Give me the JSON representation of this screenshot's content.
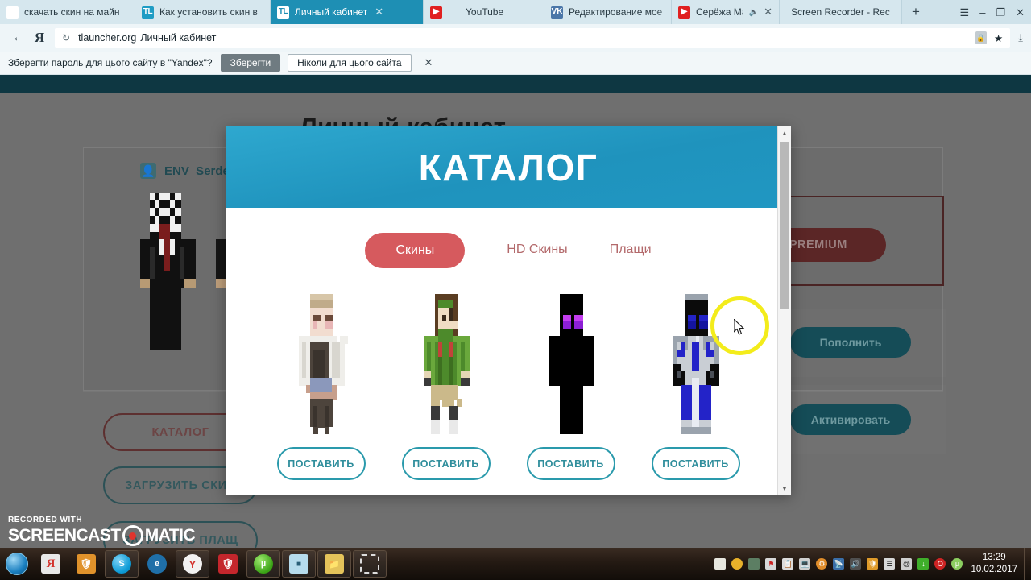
{
  "browser": {
    "tabs": [
      {
        "label": "скачать скин на майн",
        "favicon": "yandex-icon",
        "active": false,
        "closable": false,
        "muted": false
      },
      {
        "label": "Как установить скин в",
        "favicon": "tlauncher-icon",
        "active": false,
        "closable": false,
        "muted": false
      },
      {
        "label": "Личный кабинет",
        "favicon": "tlauncher-icon",
        "active": true,
        "closable": true,
        "muted": false
      },
      {
        "label": "YouTube",
        "favicon": "youtube-icon",
        "active": false,
        "closable": false,
        "muted": false
      },
      {
        "label": "Редактирование мое",
        "favicon": "vk-icon",
        "active": false,
        "closable": false,
        "muted": false
      },
      {
        "label": "Серёжа Магерк",
        "favicon": "youtube-icon",
        "active": false,
        "closable": true,
        "muted": true
      },
      {
        "label": "Screen Recorder - Rec",
        "favicon": "none",
        "active": false,
        "closable": false,
        "muted": false
      }
    ],
    "new_tab_label": "+",
    "window_controls": {
      "menu": "☰",
      "minimize": "–",
      "maximize": "❐",
      "close": "✕"
    },
    "toolbar": {
      "back_icon": "←",
      "brand_icon": "Я",
      "reload_icon": "↻",
      "url_host": "tlauncher.org",
      "url_title": "Личный кабинет",
      "lock_icon": "❖",
      "bookmark_icon": "★",
      "download_icon": "⤓"
    },
    "password_bar": {
      "text": "Зберегти пароль для цього сайту в \"Yandex\"?",
      "save_label": "Зберегти",
      "never_label": "Ніколи для цього сайта",
      "close_icon": "✕"
    }
  },
  "page": {
    "title": "Личный кабинет",
    "username": "ENV_Serden",
    "user_icon": "person-icon",
    "left_buttons": [
      {
        "label": "КАТАЛОГ",
        "style": "red-outline"
      },
      {
        "label": "ЗАГРУЗИТЬ СКИН",
        "style": "teal-outline"
      },
      {
        "label": "ЗАГРУЗИТЬ ПЛАЩ",
        "style": "teal-outline"
      }
    ],
    "premium_button": "ИТЬ PREMIUM",
    "right_buttons": [
      {
        "label": "Пополнить"
      },
      {
        "label": "Активировать"
      }
    ]
  },
  "modal": {
    "title": "КАТАЛОГ",
    "tabs": [
      {
        "label": "Скины",
        "active": true
      },
      {
        "label": "HD Скины",
        "active": false
      },
      {
        "label": "Плащи",
        "active": false
      }
    ],
    "items": [
      {
        "name": "skin-villager-girl",
        "action_label": "ПОСТАВИТЬ"
      },
      {
        "name": "skin-green-robe",
        "action_label": "ПОСТАВИТЬ"
      },
      {
        "name": "skin-enderman",
        "action_label": "ПОСТАВИТЬ"
      },
      {
        "name": "skin-blue-knight",
        "action_label": "ПОСТАВИТЬ"
      }
    ],
    "scroll_up_icon": "▲",
    "scroll_down_icon": "▼"
  },
  "watermark": {
    "recorded_with": "RECORDED WITH",
    "brand_left": "SCREENCAST",
    "brand_right": "MATIC"
  },
  "taskbar": {
    "start_icon": "windows-orb-icon",
    "items": [
      {
        "name": "yandex-browser-icon",
        "framed": false
      },
      {
        "name": "shield-app-icon",
        "framed": false
      },
      {
        "name": "skype-icon",
        "framed": true
      },
      {
        "name": "internet-explorer-icon",
        "framed": false
      },
      {
        "name": "yandex-icon",
        "framed": true
      },
      {
        "name": "antivirus-icon",
        "framed": false
      },
      {
        "name": "utorrent-icon",
        "framed": true
      },
      {
        "name": "notes-icon",
        "framed": true
      },
      {
        "name": "explorer-folder-icon",
        "framed": true
      },
      {
        "name": "screenshot-tool-icon",
        "framed": true
      }
    ],
    "tray_icons": [
      "cloud-icon",
      "update-icon",
      "steam-icon",
      "flag-icon",
      "clipboard-icon",
      "monitor-icon",
      "settings-icon",
      "network-icon",
      "volume-icon",
      "shield-icon",
      "signal-icon",
      "at-icon",
      "download-icon",
      "opera-icon",
      "utorrent-tray-icon"
    ],
    "clock_time": "13:29",
    "clock_date": "10.02.2017"
  },
  "colors": {
    "tab_active": "#1e8fb4",
    "modal_header": "#2097c2",
    "modal_tab_active": "#d65a5e",
    "set_button_border": "#2a9aac",
    "page_background": "#6f6f6f",
    "cursor_highlight": "#f3ec1b"
  }
}
